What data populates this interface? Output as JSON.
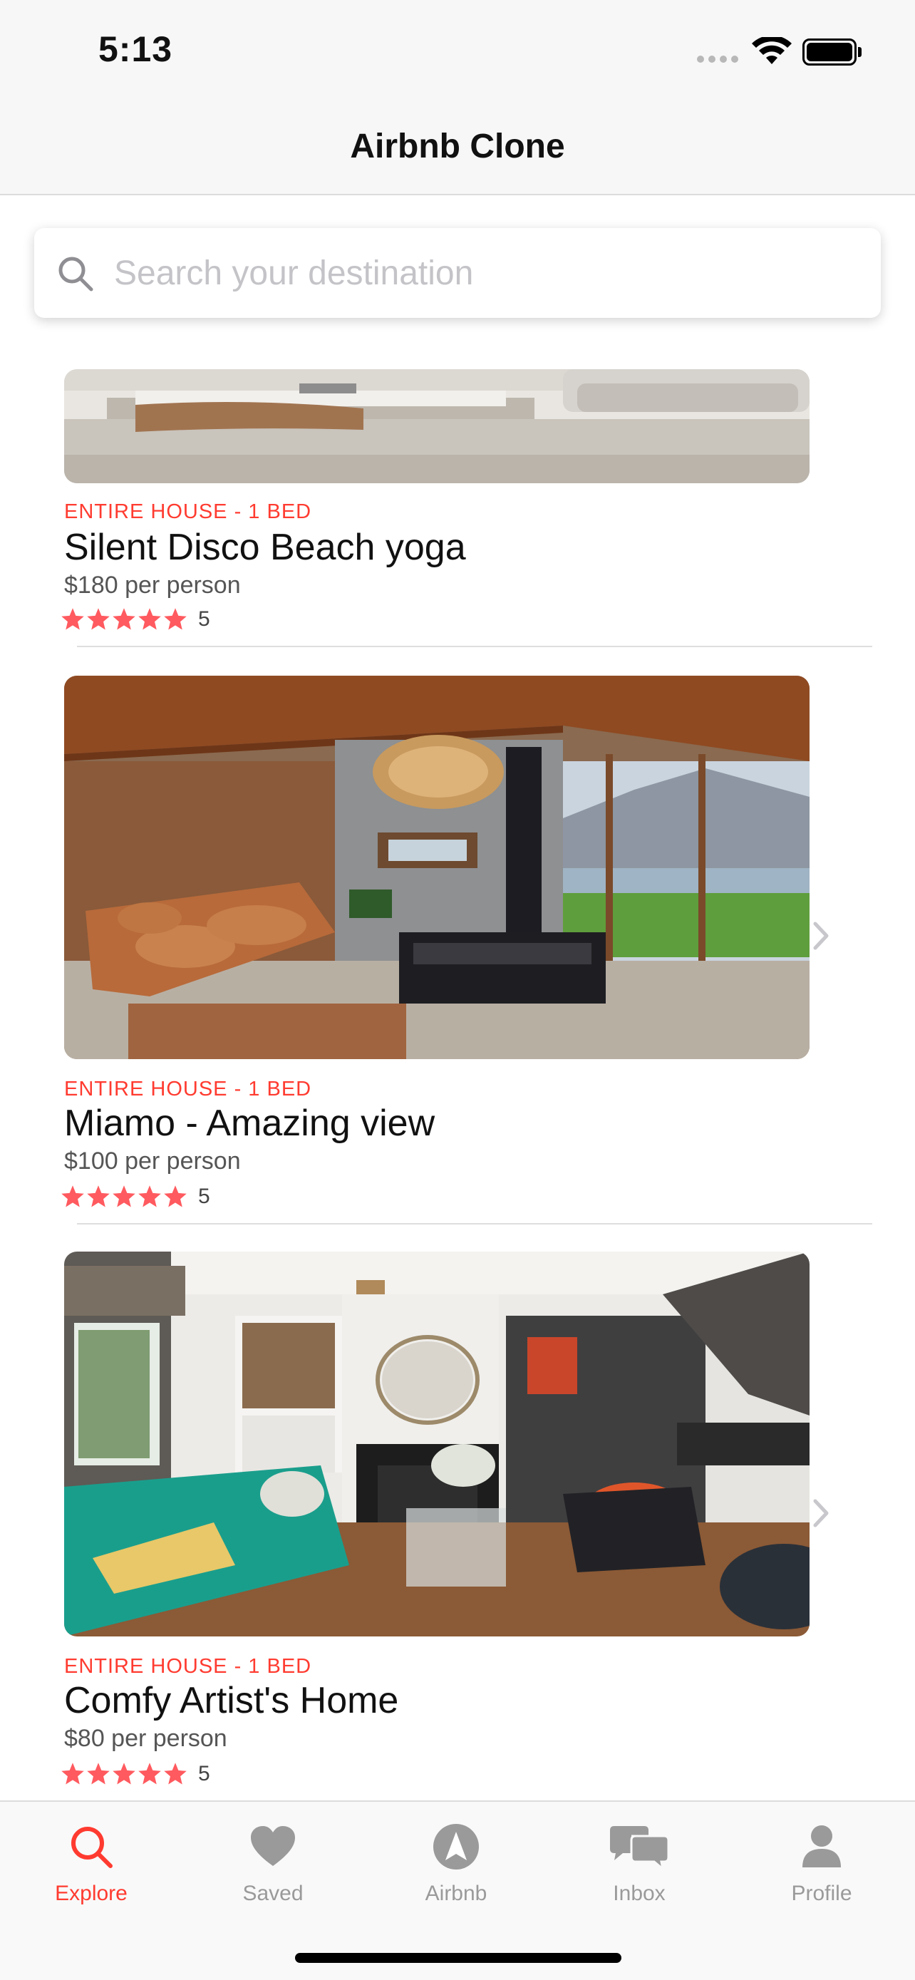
{
  "status_bar": {
    "time": "5:13"
  },
  "nav": {
    "title": "Airbnb Clone"
  },
  "search": {
    "placeholder": "Search your destination"
  },
  "listings": [
    {
      "kind": "ENTIRE HOUSE - 1 BED",
      "title": "Silent Disco Beach yoga",
      "price": "$180 per person",
      "rating_count": "5",
      "rating": 5
    },
    {
      "kind": "ENTIRE HOUSE - 1 BED",
      "title": "Miamo - Amazing view",
      "price": "$100 per person",
      "rating_count": "5",
      "rating": 5
    },
    {
      "kind": "ENTIRE HOUSE - 1 BED",
      "title": "Comfy Artist's Home",
      "price": "$80 per person",
      "rating_count": "5",
      "rating": 5
    }
  ],
  "tabs": [
    {
      "label": "Explore",
      "icon": "search-icon",
      "active": true
    },
    {
      "label": "Saved",
      "icon": "heart-icon",
      "active": false
    },
    {
      "label": "Airbnb",
      "icon": "navigation-icon",
      "active": false
    },
    {
      "label": "Inbox",
      "icon": "chat-bubbles-icon",
      "active": false
    },
    {
      "label": "Profile",
      "icon": "person-icon",
      "active": false
    }
  ],
  "colors": {
    "accent": "#ff3b30",
    "star": "#ff5a5f",
    "inactive": "#9a9a9a"
  }
}
